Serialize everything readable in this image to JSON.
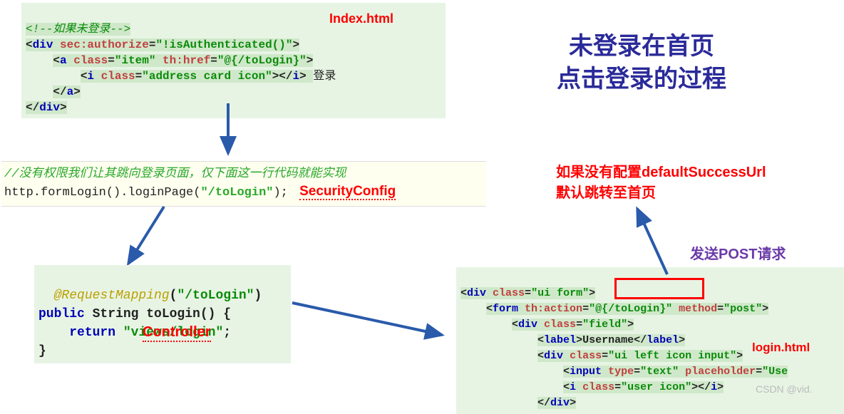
{
  "title_line1": "未登录在首页",
  "title_line2": "点击登录的过程",
  "labels": {
    "index": "Index.html",
    "security": "SecurityConfig",
    "controller": "Controller",
    "login": "login.html"
  },
  "notes": {
    "default_success_l1": "如果没有配置defaultSuccessUrl",
    "default_success_l2": "默认跳转至首页",
    "post_request": "发送POST请求"
  },
  "box1": {
    "c1": "<!--如果未登录-->",
    "c2a": "<",
    "c2b": "div",
    "c2c": " sec:authorize",
    "c2d": "=",
    "c2e": "\"!isAuthenticated()\"",
    "c2f": ">",
    "c3a": "<",
    "c3b": "a",
    "c3c": " class",
    "c3d": "=",
    "c3e": "\"item\"",
    "c3f": " th:href",
    "c3g": "=",
    "c3h": "\"@{/toLogin}\"",
    "c3i": ">",
    "c4a": "<",
    "c4b": "i",
    "c4c": " class",
    "c4d": "=",
    "c4e": "\"address card icon\"",
    "c4f": "></",
    "c4g": "i",
    "c4h": "> ",
    "c4txt": "登录",
    "c5a": "</",
    "c5b": "a",
    "c5c": ">",
    "c6a": "</",
    "c6b": "div",
    "c6c": ">"
  },
  "box2": {
    "comment": "//没有权限我们让其跳向登录页面，仅下面这一行代码就能实现",
    "code_a": "http.formLogin().loginPage(",
    "code_b": "\"/toLogin\"",
    "code_c": ");"
  },
  "box3": {
    "l1a": "@RequestMapping",
    "l1b": "(",
    "l1c": "\"/toLogin\"",
    "l1d": ")",
    "l2a": "public",
    "l2b": " String toLogin() {",
    "l3a": "return ",
    "l3b": "\"views/login\"",
    "l3c": ";",
    "l4": "}"
  },
  "box4": {
    "r1a": "<",
    "r1b": "div",
    "r1c": " class",
    "r1d": "=",
    "r1e": "\"ui form\"",
    "r1f": ">",
    "r2a": "<",
    "r2b": "form",
    "r2c": " th:action",
    "r2d": "=",
    "r2e": "\"@{/toLogin}\"",
    "r2f": " method",
    "r2g": "=",
    "r2h": "\"post\"",
    "r2i": ">",
    "r3a": "<",
    "r3b": "div",
    "r3c": " class",
    "r3d": "=",
    "r3e": "\"field\"",
    "r3f": ">",
    "r4a": "<",
    "r4b": "label",
    "r4c": ">Username</",
    "r4d": "label",
    "r4e": ">",
    "r5a": "<",
    "r5b": "div",
    "r5c": " class",
    "r5d": "=",
    "r5e": "\"ui left icon input\"",
    "r5f": ">",
    "r6a": "<",
    "r6b": "input",
    "r6c": " type",
    "r6d": "=",
    "r6e": "\"text\"",
    "r6f": " placeholder",
    "r6g": "=",
    "r6h": "\"Use",
    "r7a": "<",
    "r7b": "i",
    "r7c": " class",
    "r7d": "=",
    "r7e": "\"user icon\"",
    "r7f": "></",
    "r7g": "i",
    "r7h": ">",
    "r8a": "</",
    "r8b": "div",
    "r8c": ">"
  },
  "watermark": "CSDN @vid."
}
